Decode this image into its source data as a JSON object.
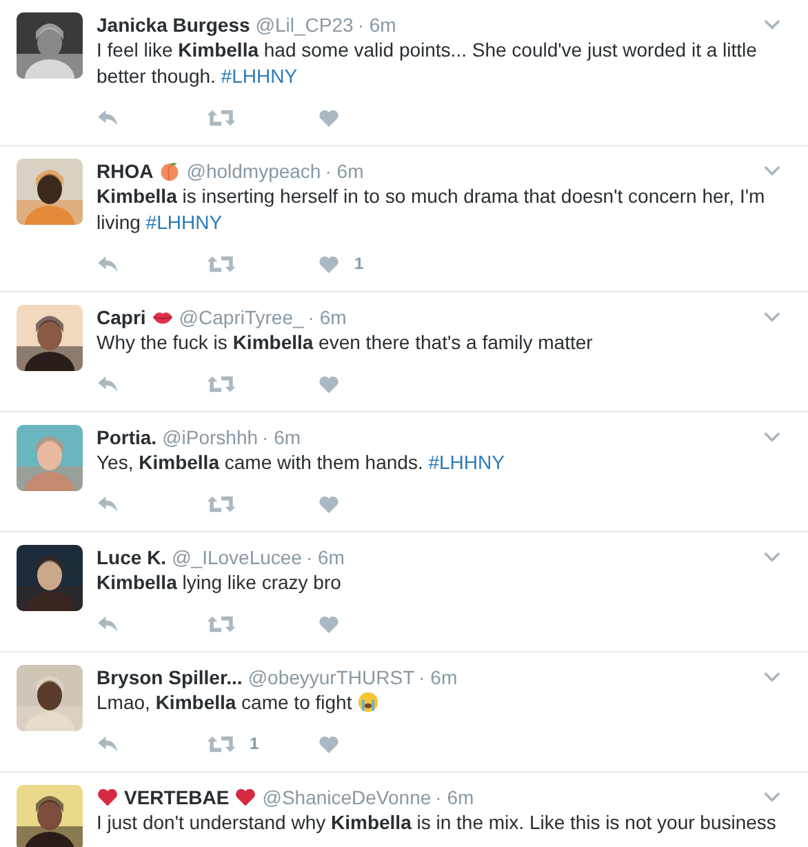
{
  "tweets": [
    {
      "name": "Janicka Burgess",
      "handle": "@Lil_CP23",
      "time": "· 6m",
      "text": [
        {
          "kind": "plain",
          "text": "I feel like "
        },
        {
          "kind": "bold",
          "text": "Kimbella"
        },
        {
          "kind": "plain",
          "text": " had some valid points... She could've just worded it a little better though. "
        },
        {
          "kind": "hashtag",
          "text": "#LHHNY"
        }
      ]
    },
    {
      "name": "RHOA",
      "handle": "@holdmypeach",
      "time": "· 6m",
      "text": [
        {
          "kind": "bold",
          "text": "Kimbella"
        },
        {
          "kind": "plain",
          "text": " is inserting herself in to so much drama that doesn't concern her, I'm living "
        },
        {
          "kind": "hashtag",
          "text": "#LHHNY"
        }
      ],
      "likes": "1"
    },
    {
      "name": "Capri",
      "handle": "@CapriTyree_",
      "time": "· 6m",
      "text": [
        {
          "kind": "plain",
          "text": "Why the fuck is "
        },
        {
          "kind": "bold",
          "text": "Kimbella"
        },
        {
          "kind": "plain",
          "text": " even there that's a family matter"
        }
      ]
    },
    {
      "name": "Portia.",
      "handle": "@iPorshhh",
      "time": "· 6m",
      "text": [
        {
          "kind": "plain",
          "text": "Yes, "
        },
        {
          "kind": "bold",
          "text": "Kimbella"
        },
        {
          "kind": "plain",
          "text": " came with them hands. "
        },
        {
          "kind": "hashtag",
          "text": "#LHHNY"
        }
      ]
    },
    {
      "name": "Luce K.",
      "handle": "@_ILoveLucee",
      "time": "· 6m",
      "text": [
        {
          "kind": "bold",
          "text": "Kimbella"
        },
        {
          "kind": "plain",
          "text": " lying like crazy bro"
        }
      ]
    },
    {
      "name": "Bryson Spiller...",
      "handle": "@obeyyurTHURST",
      "time": "· 6m",
      "text": [
        {
          "kind": "plain",
          "text": "Lmao, "
        },
        {
          "kind": "bold",
          "text": "Kimbella"
        },
        {
          "kind": "plain",
          "text": " came to fight "
        },
        {
          "kind": "emoji"
        }
      ],
      "retweets": "1"
    },
    {
      "name": "VERTEBAE",
      "handle": "@ShaniceDeVonne",
      "time": "· 6m",
      "text": [
        {
          "kind": "plain",
          "text": "I just don't understand why "
        },
        {
          "kind": "bold",
          "text": "Kimbella"
        },
        {
          "kind": "plain",
          "text": " is in the mix. Like this is not your business"
        }
      ]
    }
  ]
}
